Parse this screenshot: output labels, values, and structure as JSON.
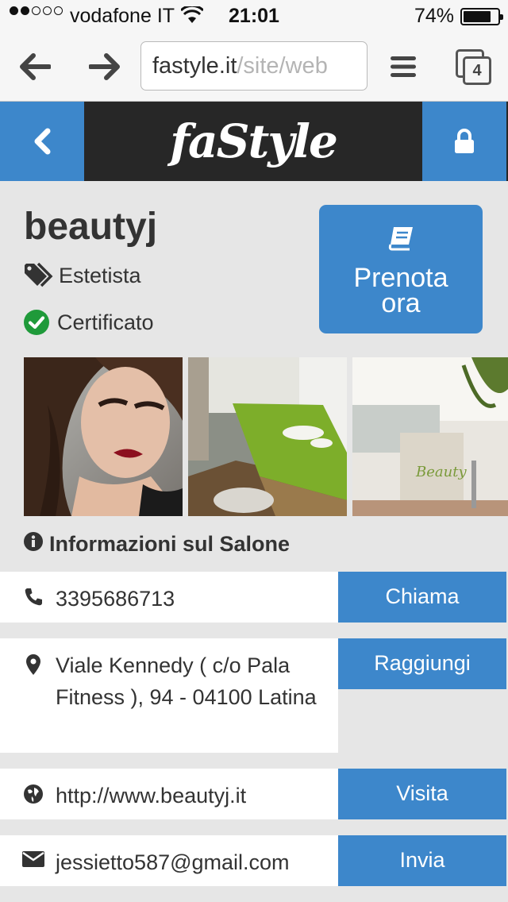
{
  "status_bar": {
    "carrier": "vodafone IT",
    "time": "21:01",
    "battery": "74%",
    "signal_bars": 2,
    "signal_total": 5,
    "battery_level": 0.74
  },
  "browser": {
    "url_host": "fastyle.it",
    "url_path": "/site/web",
    "tab_count": "4"
  },
  "site": {
    "logo": "faStyle"
  },
  "profile": {
    "name": "beautyj",
    "category": "Estetista",
    "certified": "Certificato",
    "book_label_line1": "Prenota",
    "book_label_line2": "ora"
  },
  "info": {
    "title": "Informazioni sul Salone",
    "phone": "3395686713",
    "phone_action": "Chiama",
    "address": "Viale Kennedy ( c/o Pala Fitness ), 94 - 04100 Latina",
    "address_action": "Raggiungi",
    "website": "http://www.beautyj.it",
    "website_action": "Visita",
    "email": "jessietto587@gmail.com",
    "email_action": "Invia"
  },
  "colors": {
    "accent": "#3d87cb",
    "header_bg": "#272727",
    "page_bg": "#e6e6e6",
    "certified_green": "#1f9a3a"
  },
  "icons": {
    "phone": "phone-icon",
    "address": "map-pin-icon",
    "website": "globe-icon",
    "email": "envelope-icon"
  }
}
